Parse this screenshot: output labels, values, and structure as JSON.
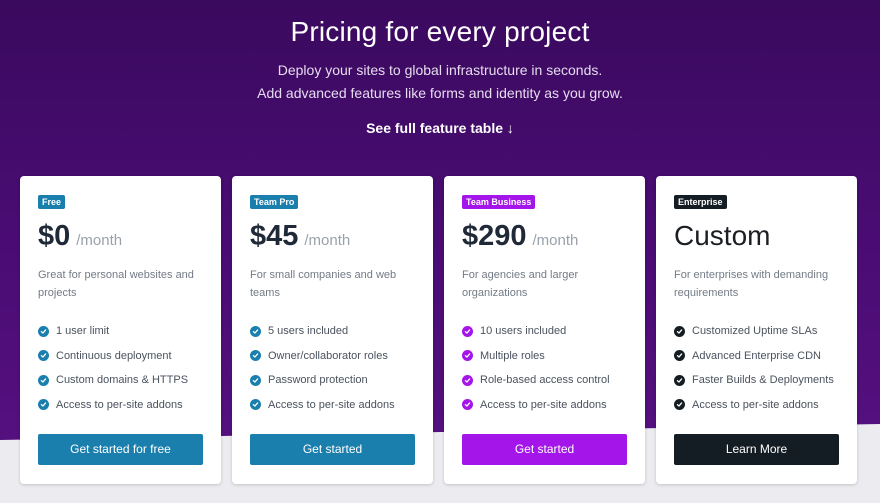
{
  "hero": {
    "title": "Pricing for every project",
    "subtitle_line1": "Deploy your sites to global infrastructure in seconds.",
    "subtitle_line2": "Add advanced features like forms and identity as you grow.",
    "feature_table_link": "See full feature table ↓"
  },
  "plans": [
    {
      "badge": "Free",
      "price": "$0",
      "period": "/month",
      "description": "Great for personal websites and projects",
      "features": [
        "1 user limit",
        "Continuous deployment",
        "Custom domains & HTTPS",
        "Access to per-site addons"
      ],
      "cta": "Get started for free",
      "accent": "#1b7fad",
      "check_color": "#1b7fad"
    },
    {
      "badge": "Team Pro",
      "price": "$45",
      "period": "/month",
      "description": "For small companies and web teams",
      "features": [
        "5 users included",
        "Owner/collaborator roles",
        "Password protection",
        "Access to per-site addons"
      ],
      "cta": "Get started",
      "accent": "#1b7fad",
      "check_color": "#1b7fad"
    },
    {
      "badge": "Team Business",
      "price": "$290",
      "period": "/month",
      "description": "For agencies and larger organizations",
      "features": [
        "10 users included",
        "Multiple roles",
        "Role-based access control",
        "Access to per-site addons"
      ],
      "cta": "Get started",
      "accent": "#a315e8",
      "check_color": "#a315e8"
    },
    {
      "badge": "Enterprise",
      "price": "Custom",
      "period": "",
      "description": "For enterprises with demanding requirements",
      "features": [
        "Customized Uptime SLAs",
        "Advanced Enterprise CDN",
        "Faster Builds & Deployments",
        "Access to per-site addons"
      ],
      "cta": "Learn More",
      "accent": "#141d24",
      "check_color": "#141d24"
    }
  ],
  "icons": {
    "feature_check": "check-circle-icon"
  }
}
